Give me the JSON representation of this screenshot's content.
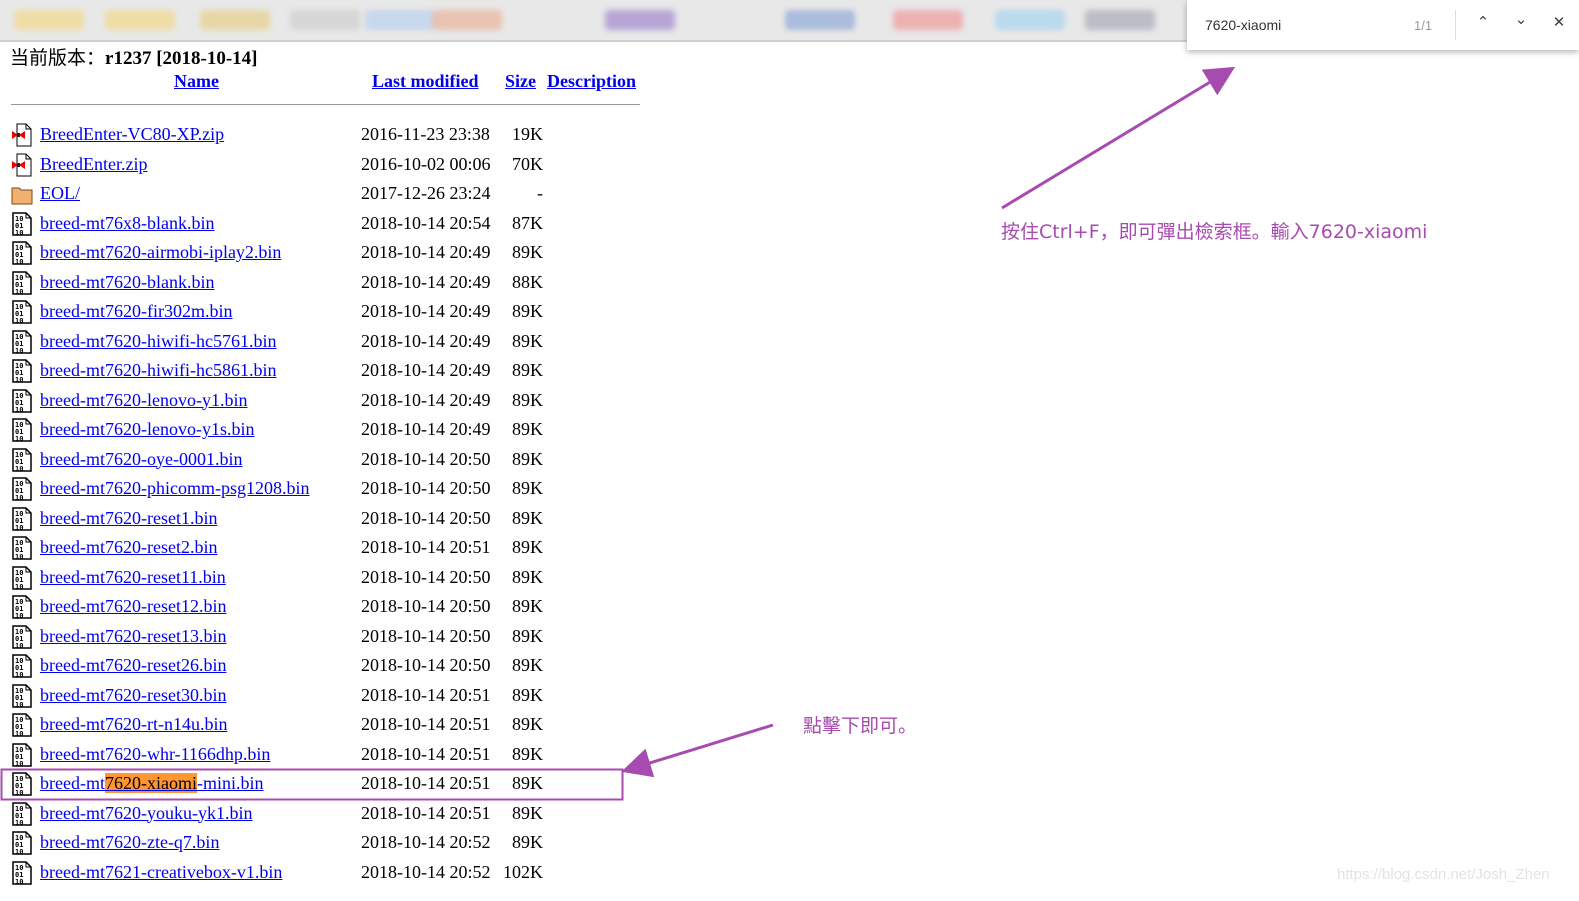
{
  "find_bar": {
    "query": "7620-xiaomi",
    "match_count": "1/1",
    "prev_icon": "chevron-up-icon",
    "next_icon": "chevron-down-icon",
    "close_icon": "close-icon"
  },
  "page": {
    "version_label": "当前版本：",
    "version_value": "r1237 [2018-10-14]",
    "columns": {
      "name": "Name",
      "last_modified": "Last modified",
      "size": "Size",
      "description": "Description"
    },
    "files": [
      {
        "name": "BreedEnter-VC80-XP.zip",
        "modified": "2016-11-23 23:38",
        "size": "19K",
        "icon": "zip"
      },
      {
        "name": "BreedEnter.zip",
        "modified": "2016-10-02 00:06",
        "size": "70K",
        "icon": "zip"
      },
      {
        "name": "EOL/",
        "modified": "2017-12-26 23:24",
        "size": "-",
        "icon": "folder"
      },
      {
        "name": "breed-mt76x8-blank.bin",
        "modified": "2018-10-14 20:54",
        "size": "87K",
        "icon": "binary"
      },
      {
        "name": "breed-mt7620-airmobi-iplay2.bin",
        "modified": "2018-10-14 20:49",
        "size": "89K",
        "icon": "binary"
      },
      {
        "name": "breed-mt7620-blank.bin",
        "modified": "2018-10-14 20:49",
        "size": "88K",
        "icon": "binary"
      },
      {
        "name": "breed-mt7620-fir302m.bin",
        "modified": "2018-10-14 20:49",
        "size": "89K",
        "icon": "binary"
      },
      {
        "name": "breed-mt7620-hiwifi-hc5761.bin",
        "modified": "2018-10-14 20:49",
        "size": "89K",
        "icon": "binary"
      },
      {
        "name": "breed-mt7620-hiwifi-hc5861.bin",
        "modified": "2018-10-14 20:49",
        "size": "89K",
        "icon": "binary"
      },
      {
        "name": "breed-mt7620-lenovo-y1.bin",
        "modified": "2018-10-14 20:49",
        "size": "89K",
        "icon": "binary"
      },
      {
        "name": "breed-mt7620-lenovo-y1s.bin",
        "modified": "2018-10-14 20:49",
        "size": "89K",
        "icon": "binary"
      },
      {
        "name": "breed-mt7620-oye-0001.bin",
        "modified": "2018-10-14 20:50",
        "size": "89K",
        "icon": "binary"
      },
      {
        "name": "breed-mt7620-phicomm-psg1208.bin",
        "modified": "2018-10-14 20:50",
        "size": "89K",
        "icon": "binary"
      },
      {
        "name": "breed-mt7620-reset1.bin",
        "modified": "2018-10-14 20:50",
        "size": "89K",
        "icon": "binary"
      },
      {
        "name": "breed-mt7620-reset2.bin",
        "modified": "2018-10-14 20:51",
        "size": "89K",
        "icon": "binary"
      },
      {
        "name": "breed-mt7620-reset11.bin",
        "modified": "2018-10-14 20:50",
        "size": "89K",
        "icon": "binary"
      },
      {
        "name": "breed-mt7620-reset12.bin",
        "modified": "2018-10-14 20:50",
        "size": "89K",
        "icon": "binary"
      },
      {
        "name": "breed-mt7620-reset13.bin",
        "modified": "2018-10-14 20:50",
        "size": "89K",
        "icon": "binary"
      },
      {
        "name": "breed-mt7620-reset26.bin",
        "modified": "2018-10-14 20:50",
        "size": "89K",
        "icon": "binary"
      },
      {
        "name": "breed-mt7620-reset30.bin",
        "modified": "2018-10-14 20:51",
        "size": "89K",
        "icon": "binary"
      },
      {
        "name": "breed-mt7620-rt-n14u.bin",
        "modified": "2018-10-14 20:51",
        "size": "89K",
        "icon": "binary"
      },
      {
        "name": "breed-mt7620-whr-1166dhp.bin",
        "modified": "2018-10-14 20:51",
        "size": "89K",
        "icon": "binary"
      },
      {
        "name": "breed-mt7620-xiaomi-mini.bin",
        "modified": "2018-10-14 20:51",
        "size": "89K",
        "icon": "binary",
        "highlighted": true
      },
      {
        "name": "breed-mt7620-youku-yk1.bin",
        "modified": "2018-10-14 20:51",
        "size": "89K",
        "icon": "binary"
      },
      {
        "name": "breed-mt7620-zte-q7.bin",
        "modified": "2018-10-14 20:52",
        "size": "89K",
        "icon": "binary"
      },
      {
        "name": "breed-mt7621-creativebox-v1.bin",
        "modified": "2018-10-14 20:52",
        "size": "102K",
        "icon": "binary"
      }
    ]
  },
  "annotations": {
    "find_note": "按住Ctrl+F，即可彈出檢索框。輸入7620-xiaomi",
    "click_note": "點擊下即可。",
    "color": "#a84bb0",
    "highlight_color": "#ff9632"
  },
  "watermark": "https://blog.csdn.net/Josh_Zhen"
}
